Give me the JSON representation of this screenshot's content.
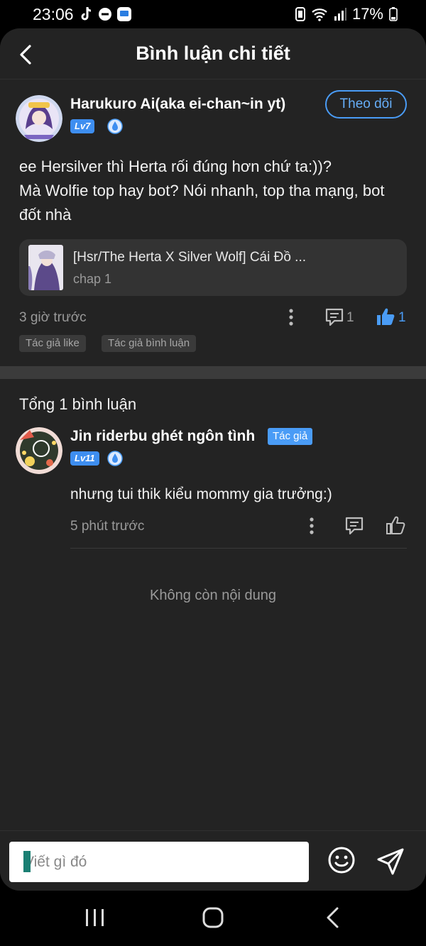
{
  "status_bar": {
    "time": "23:06",
    "battery": "17%"
  },
  "header": {
    "title": "Bình luận chi tiết"
  },
  "main_comment": {
    "username": "Harukuro Ai(aka ei-chan~in yt)",
    "level": "Lv7",
    "follow_label": "Theo dõi",
    "text_line1": "ee Hersilver thì Herta rối đúng hơn chứ ta:))?",
    "text_line2": "Mà Wolfie top hay bot? Nói nhanh, top tha mạng, bot",
    "text_line3": "đốt nhà",
    "linked": {
      "title": "[Hsr/The Herta X Silver Wolf] Cái Đồ ...",
      "subtitle": "chap 1"
    },
    "time_ago": "3 giờ trước",
    "reply_count": "1",
    "like_count": "1",
    "chips": [
      "Tác giả like",
      "Tác giả bình luận"
    ]
  },
  "replies_section": {
    "total_label": "Tổng 1 bình luận",
    "reply": {
      "username": "Jin riderbu ghét ngôn tình",
      "author_tag": "Tác giả",
      "level": "Lv11",
      "text": "nhưng tui thik kiểu mommy gia trưởng:)",
      "time_ago": "5 phút trước"
    },
    "end_text": "Không còn nội dung"
  },
  "composer": {
    "placeholder": "Viết gì đó"
  },
  "colors": {
    "background": "#232323",
    "accent": "#4a9cf6",
    "muted_text": "#9a9a9a"
  }
}
